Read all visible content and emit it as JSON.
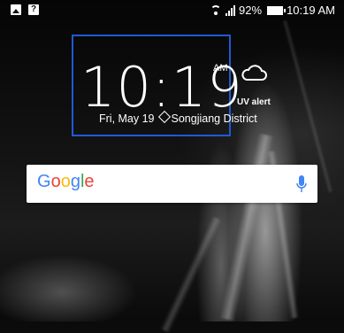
{
  "status_bar": {
    "battery": "92%",
    "time": "10:19 AM",
    "icons": [
      "image-notification-icon",
      "question-notification-icon",
      "wifi-icon",
      "signal-icon",
      "battery-icon"
    ]
  },
  "clock_widget": {
    "time": "10:19",
    "ampm": "AM",
    "date": "Fri, May 19",
    "location": "Songjiang District",
    "weather_icon": "cloud-icon",
    "uv_text": "UV alert",
    "highlight_color": "#1e5ad6"
  },
  "search": {
    "logo_letters": [
      {
        "char": "G",
        "color": "#4285F4"
      },
      {
        "char": "o",
        "color": "#EA4335"
      },
      {
        "char": "o",
        "color": "#FBBC05"
      },
      {
        "char": "g",
        "color": "#4285F4"
      },
      {
        "char": "l",
        "color": "#34A853"
      },
      {
        "char": "e",
        "color": "#EA4335"
      }
    ],
    "mic_icon": "microphone-icon",
    "mic_color": "#4285F4"
  }
}
